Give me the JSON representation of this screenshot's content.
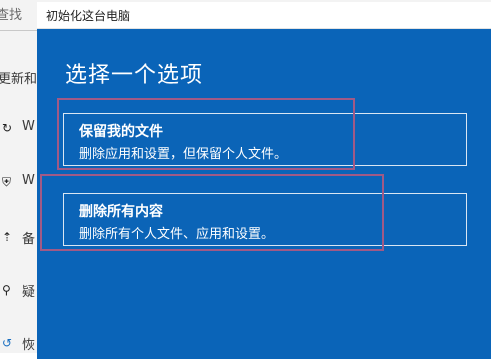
{
  "background": {
    "search_label": "查找",
    "items": [
      {
        "icon": "update-icon",
        "text": "更新和"
      },
      {
        "icon": "refresh-icon",
        "text": "W"
      },
      {
        "icon": "shield-icon",
        "text": "W"
      },
      {
        "icon": "backup-icon",
        "text": "备"
      },
      {
        "icon": "troubleshoot-icon",
        "text": "疑"
      },
      {
        "icon": "recovery-icon",
        "text": "恢"
      }
    ]
  },
  "dialog": {
    "title": "初始化这台电脑",
    "heading": "选择一个选项",
    "options": [
      {
        "title": "保留我的文件",
        "description": "删除应用和设置，但保留个人文件。"
      },
      {
        "title": "删除所有内容",
        "description": "删除所有个人文件、应用和设置。"
      }
    ]
  },
  "colors": {
    "dialog_background": "#0a64b8",
    "card_border": "#d9e6f3",
    "highlight_frame": "#a15a86",
    "text_on_blue": "#ffffff"
  }
}
